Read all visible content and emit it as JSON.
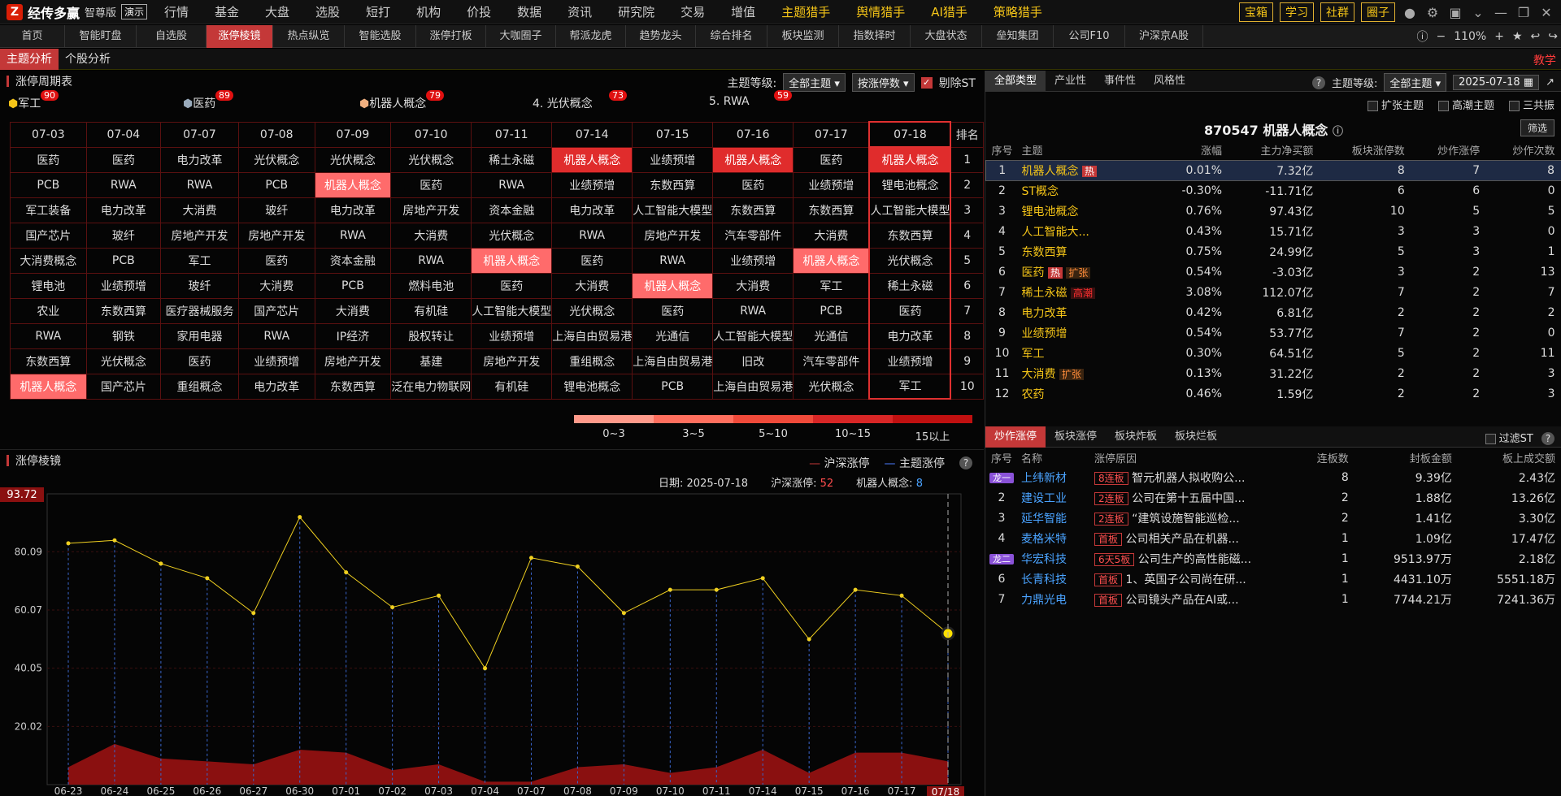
{
  "app": {
    "logo_mark": "Z",
    "name": "经传多赢",
    "edition": "智尊版",
    "demo": "演示"
  },
  "top_menu": [
    {
      "label": "行情",
      "hl": false
    },
    {
      "label": "基金",
      "hl": false
    },
    {
      "label": "大盘",
      "hl": false
    },
    {
      "label": "选股",
      "hl": false
    },
    {
      "label": "短打",
      "hl": false
    },
    {
      "label": "机构",
      "hl": false
    },
    {
      "label": "价投",
      "hl": false
    },
    {
      "label": "数据",
      "hl": false
    },
    {
      "label": "资讯",
      "hl": false
    },
    {
      "label": "研究院",
      "hl": false
    },
    {
      "label": "交易",
      "hl": false
    },
    {
      "label": "增值",
      "hl": false
    },
    {
      "label": "主题猎手",
      "hl": true
    },
    {
      "label": "舆情猎手",
      "hl": true
    },
    {
      "label": "AI猎手",
      "hl": true
    },
    {
      "label": "策略猎手",
      "hl": true
    }
  ],
  "top_buttons": [
    "宝箱",
    "学习",
    "社群",
    "圈子"
  ],
  "tabs": [
    "首页",
    "智能盯盘",
    "自选股",
    "涨停棱镜",
    "热点纵览",
    "智能选股",
    "涨停打板",
    "大咖圈子",
    "帮派龙虎",
    "趋势龙头",
    "综合排名",
    "板块监测",
    "指数择时",
    "大盘状态",
    "垒知集团",
    "公司F10",
    "沪深京A股"
  ],
  "active_tab": "涨停棱镜",
  "zoom": "110%",
  "subtabs": [
    "主题分析",
    "个股分析"
  ],
  "teach": "教学",
  "cycle": {
    "title": "涨停周期表",
    "level_label": "主题等级:",
    "level_value": "全部主题",
    "sort_value": "按涨停数",
    "st_label": "剔除ST",
    "legend": [
      {
        "label": "军工",
        "count": "90",
        "prefix": "⬢"
      },
      {
        "label": "医药",
        "count": "89",
        "prefix": "⬢"
      },
      {
        "label": "机器人概念",
        "count": "79",
        "prefix": "⬢"
      },
      {
        "label": "4. 光伏概念",
        "count": "73",
        "prefix": ""
      },
      {
        "label": "5. RWA",
        "count": "59",
        "prefix": ""
      }
    ],
    "dates": [
      "07-03",
      "07-04",
      "07-07",
      "07-08",
      "07-09",
      "07-10",
      "07-11",
      "07-14",
      "07-15",
      "07-16",
      "07-17",
      "07-18"
    ],
    "rank_header": "排名",
    "rows": [
      [
        "医药",
        "医药",
        "电力改革",
        "光伏概念",
        "光伏概念",
        "光伏概念",
        "稀土永磁",
        "机器人概念",
        "业绩预增",
        "机器人概念",
        "医药",
        "机器人概念"
      ],
      [
        "PCB",
        "RWA",
        "RWA",
        "PCB",
        "机器人概念",
        "医药",
        "RWA",
        "业绩预增",
        "东数西算",
        "医药",
        "业绩预增",
        "锂电池概念"
      ],
      [
        "军工装备",
        "电力改革",
        "大消费",
        "玻纤",
        "电力改革",
        "房地产开发",
        "资本金融",
        "电力改革",
        "人工智能大模型",
        "东数西算",
        "东数西算",
        "人工智能大模型"
      ],
      [
        "国产芯片",
        "玻纤",
        "房地产开发",
        "房地产开发",
        "RWA",
        "大消费",
        "光伏概念",
        "RWA",
        "房地产开发",
        "汽车零部件",
        "大消费",
        "东数西算"
      ],
      [
        "大消费概念",
        "PCB",
        "军工",
        "医药",
        "资本金融",
        "RWA",
        "机器人概念",
        "医药",
        "RWA",
        "业绩预增",
        "机器人概念",
        "光伏概念"
      ],
      [
        "锂电池",
        "业绩预增",
        "玻纤",
        "大消费",
        "PCB",
        "燃料电池",
        "医药",
        "大消费",
        "机器人概念",
        "大消费",
        "军工",
        "稀土永磁"
      ],
      [
        "农业",
        "东数西算",
        "医疗器械服务",
        "国产芯片",
        "大消费",
        "有机硅",
        "人工智能大模型",
        "光伏概念",
        "医药",
        "RWA",
        "PCB",
        "医药"
      ],
      [
        "RWA",
        "钢铁",
        "家用电器",
        "RWA",
        "IP经济",
        "股权转让",
        "业绩预增",
        "上海自由贸易港",
        "光通信",
        "人工智能大模型",
        "光通信",
        "电力改革"
      ],
      [
        "东数西算",
        "光伏概念",
        "医药",
        "业绩预增",
        "房地产开发",
        "基建",
        "房地产开发",
        "重组概念",
        "上海自由贸易港",
        "旧改",
        "汽车零部件",
        "业绩预增"
      ],
      [
        "机器人概念",
        "国产芯片",
        "重组概念",
        "电力改革",
        "东数西算",
        "泛在电力物联网",
        "有机硅",
        "锂电池概念",
        "PCB",
        "上海自由贸易港",
        "光伏概念",
        "军工"
      ]
    ],
    "ranks": [
      "1",
      "2",
      "3",
      "4",
      "5",
      "6",
      "7",
      "8",
      "9",
      "10"
    ],
    "scale": [
      {
        "label": "0~3",
        "color": "#ff9a8a"
      },
      {
        "label": "3~5",
        "color": "#ff6f5e"
      },
      {
        "label": "5~10",
        "color": "#f04a3a"
      },
      {
        "label": "10~15",
        "color": "#d82626"
      },
      {
        "label": "15以上",
        "color": "#c01010"
      }
    ]
  },
  "prism": {
    "title": "涨停棱镜",
    "legend_a": "沪深涨停",
    "legend_b": "主题涨停",
    "info_date_label": "日期:",
    "info_date": "2025-07-18",
    "info_a_label": "沪深涨停:",
    "info_a_value": "52",
    "info_b_label": "机器人概念:",
    "info_b_value": "8",
    "cursor_label": "93.72",
    "hover_date": "07/18"
  },
  "chart_data": {
    "type": "line",
    "x": [
      "06-23",
      "06-24",
      "06-25",
      "06-26",
      "06-27",
      "06-30",
      "07-01",
      "07-02",
      "07-03",
      "07-04",
      "07-07",
      "07-08",
      "07-09",
      "07-10",
      "07-11",
      "07-14",
      "07-15",
      "07-16",
      "07-17",
      "07-18"
    ],
    "y_ticks": [
      "80.09",
      "60.07",
      "40.05",
      "20.02"
    ],
    "ylim": [
      0,
      100
    ],
    "series": [
      {
        "name": "沪深涨停",
        "color": "#f0d020",
        "values": [
          83,
          84,
          76,
          71,
          59,
          92,
          73,
          61,
          65,
          40,
          78,
          75,
          59,
          67,
          67,
          71,
          50,
          67,
          65,
          52
        ]
      },
      {
        "name": "主题涨停",
        "color": "#8a1010",
        "values": [
          6,
          14,
          9,
          8,
          7,
          12,
          11,
          5,
          7,
          1,
          1,
          6,
          7,
          4,
          6,
          12,
          4,
          11,
          11,
          8
        ]
      }
    ]
  },
  "right_panel": {
    "tabs": [
      "全部类型",
      "产业性",
      "事件性",
      "风格性"
    ],
    "level_label": "主题等级:",
    "level_value": "全部主题",
    "date": "2025-07-18",
    "checks": [
      "扩张主题",
      "高潮主题",
      "三共振"
    ],
    "stock_title": "870547 机器人概念",
    "filter_btn": "筛选",
    "headers": [
      "序号",
      "主题",
      "涨幅",
      "主力净买额",
      "板块涨停数",
      "炒作涨停",
      "炒作次数"
    ],
    "rows": [
      {
        "no": "1",
        "name": "机器人概念",
        "tag": "热",
        "tag2": "",
        "chg": "0.01%",
        "net": "7.32亿",
        "zt": "8",
        "cz": "7",
        "cs": "8",
        "up": true,
        "netup": true,
        "sel": true
      },
      {
        "no": "2",
        "name": "ST概念",
        "tag": "",
        "tag2": "",
        "chg": "-0.30%",
        "net": "-11.71亿",
        "zt": "6",
        "cz": "6",
        "cs": "0",
        "up": false,
        "netup": false,
        "sel": false
      },
      {
        "no": "3",
        "name": "锂电池概念",
        "tag": "",
        "tag2": "",
        "chg": "0.76%",
        "net": "97.43亿",
        "zt": "10",
        "cz": "5",
        "cs": "5",
        "up": true,
        "netup": true,
        "sel": false
      },
      {
        "no": "4",
        "name": "人工智能大...",
        "tag": "",
        "tag2": "",
        "chg": "0.43%",
        "net": "15.71亿",
        "zt": "3",
        "cz": "3",
        "cs": "0",
        "up": true,
        "netup": true,
        "sel": false
      },
      {
        "no": "5",
        "name": "东数西算",
        "tag": "",
        "tag2": "",
        "chg": "0.75%",
        "net": "24.99亿",
        "zt": "5",
        "cz": "3",
        "cs": "1",
        "up": true,
        "netup": true,
        "sel": false
      },
      {
        "no": "6",
        "name": "医药",
        "tag": "热",
        "tag2": "扩张",
        "chg": "0.54%",
        "net": "-3.03亿",
        "zt": "3",
        "cz": "2",
        "cs": "13",
        "up": true,
        "netup": false,
        "sel": false
      },
      {
        "no": "7",
        "name": "稀土永磁",
        "tag": "",
        "tag2": "高潮",
        "chg": "3.08%",
        "net": "112.07亿",
        "zt": "7",
        "cz": "2",
        "cs": "7",
        "up": true,
        "netup": true,
        "sel": false
      },
      {
        "no": "8",
        "name": "电力改革",
        "tag": "",
        "tag2": "",
        "chg": "0.42%",
        "net": "6.81亿",
        "zt": "2",
        "cz": "2",
        "cs": "2",
        "up": true,
        "netup": true,
        "sel": false
      },
      {
        "no": "9",
        "name": "业绩预增",
        "tag": "",
        "tag2": "",
        "chg": "0.54%",
        "net": "53.77亿",
        "zt": "7",
        "cz": "2",
        "cs": "0",
        "up": true,
        "netup": true,
        "sel": false
      },
      {
        "no": "10",
        "name": "军工",
        "tag": "",
        "tag2": "",
        "chg": "0.30%",
        "net": "64.51亿",
        "zt": "5",
        "cz": "2",
        "cs": "11",
        "up": true,
        "netup": true,
        "sel": false
      },
      {
        "no": "11",
        "name": "大消费",
        "tag": "",
        "tag2": "扩张",
        "chg": "0.13%",
        "net": "31.22亿",
        "zt": "2",
        "cz": "2",
        "cs": "3",
        "up": true,
        "netup": true,
        "sel": false
      },
      {
        "no": "12",
        "name": "农药",
        "tag": "",
        "tag2": "",
        "chg": "0.46%",
        "net": "1.59亿",
        "zt": "2",
        "cz": "2",
        "cs": "3",
        "up": true,
        "netup": true,
        "sel": false
      }
    ],
    "btabs": [
      "炒作涨停",
      "板块涨停",
      "板块炸板",
      "板块烂板"
    ],
    "st_filter": "过滤ST",
    "bheaders": [
      "序号",
      "名称",
      "涨停原因",
      "连板数",
      "封板金额",
      "板上成交额"
    ],
    "brows": [
      {
        "no": "龙一",
        "name": "上纬新材",
        "tag": "8连板",
        "reason": "智元机器人拟收购公...",
        "lb": "8",
        "fb": "9.39亿",
        "cj": "2.43亿",
        "dragon": true
      },
      {
        "no": "2",
        "name": "建设工业",
        "tag": "2连板",
        "reason": "公司在第十五届中国...",
        "lb": "2",
        "fb": "1.88亿",
        "cj": "13.26亿",
        "dragon": false
      },
      {
        "no": "3",
        "name": "延华智能",
        "tag": "2连板",
        "reason": "“建筑设施智能巡检...",
        "lb": "2",
        "fb": "1.41亿",
        "cj": "3.30亿",
        "dragon": false
      },
      {
        "no": "4",
        "name": "麦格米特",
        "tag": "首板",
        "reason": "公司相关产品在机器...",
        "lb": "1",
        "fb": "1.09亿",
        "cj": "17.47亿",
        "dragon": false
      },
      {
        "no": "龙二",
        "name": "华宏科技",
        "tag": "6天5板",
        "reason": "公司生产的高性能磁...",
        "lb": "1",
        "fb": "9513.97万",
        "cj": "2.18亿",
        "dragon": true
      },
      {
        "no": "6",
        "name": "长青科技",
        "tag": "首板",
        "reason": "1、英国子公司尚在研...",
        "lb": "1",
        "fb": "4431.10万",
        "cj": "5551.18万",
        "dragon": false
      },
      {
        "no": "7",
        "name": "力鼎光电",
        "tag": "首板",
        "reason": "公司镜头产品在AI或...",
        "lb": "1",
        "fb": "7744.21万",
        "cj": "7241.36万",
        "dragon": false
      }
    ]
  }
}
